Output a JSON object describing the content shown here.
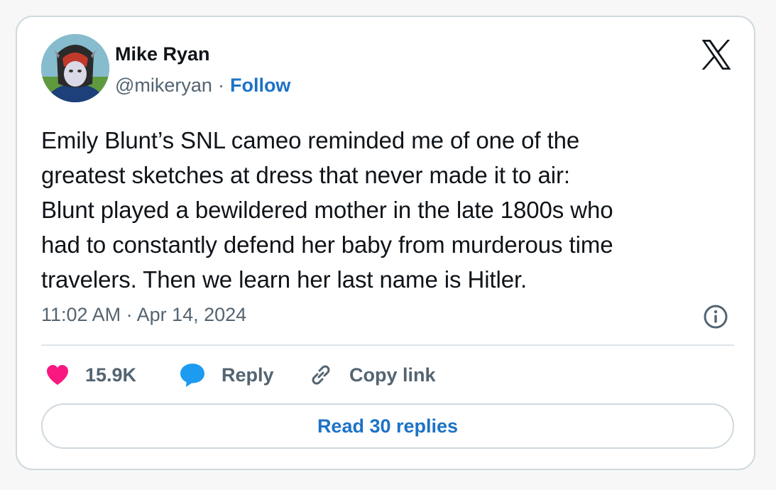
{
  "author": {
    "name": "Mike Ryan",
    "handle": "@mikeryan",
    "separator": "·",
    "follow_label": "Follow"
  },
  "tweet": {
    "lines": [
      "Emily Blunt’s SNL cameo reminded me of one of the",
      "greatest sketches at dress that never made it to air:",
      "Blunt played a bewildered mother in the late 1800s who",
      "had to constantly defend her baby from murderous time",
      "travelers. Then we learn her last name is Hitler."
    ],
    "timestamp": "11:02 AM · Apr 14, 2024"
  },
  "actions": {
    "like_count": "15.9K",
    "reply_label": "Reply",
    "copy_label": "Copy link"
  },
  "read_replies_label": "Read 30 replies",
  "icons": {
    "brand": "x-logo-icon",
    "info": "info-icon",
    "like": "heart-icon",
    "reply": "speech-bubble-icon",
    "copy": "link-icon"
  },
  "colors": {
    "link_blue": "#1d72c7",
    "heart_pink": "#f91880",
    "reply_blue": "#1d9bf0",
    "text_primary": "#0f1419",
    "text_secondary": "#536471",
    "border": "#cfd9de"
  }
}
